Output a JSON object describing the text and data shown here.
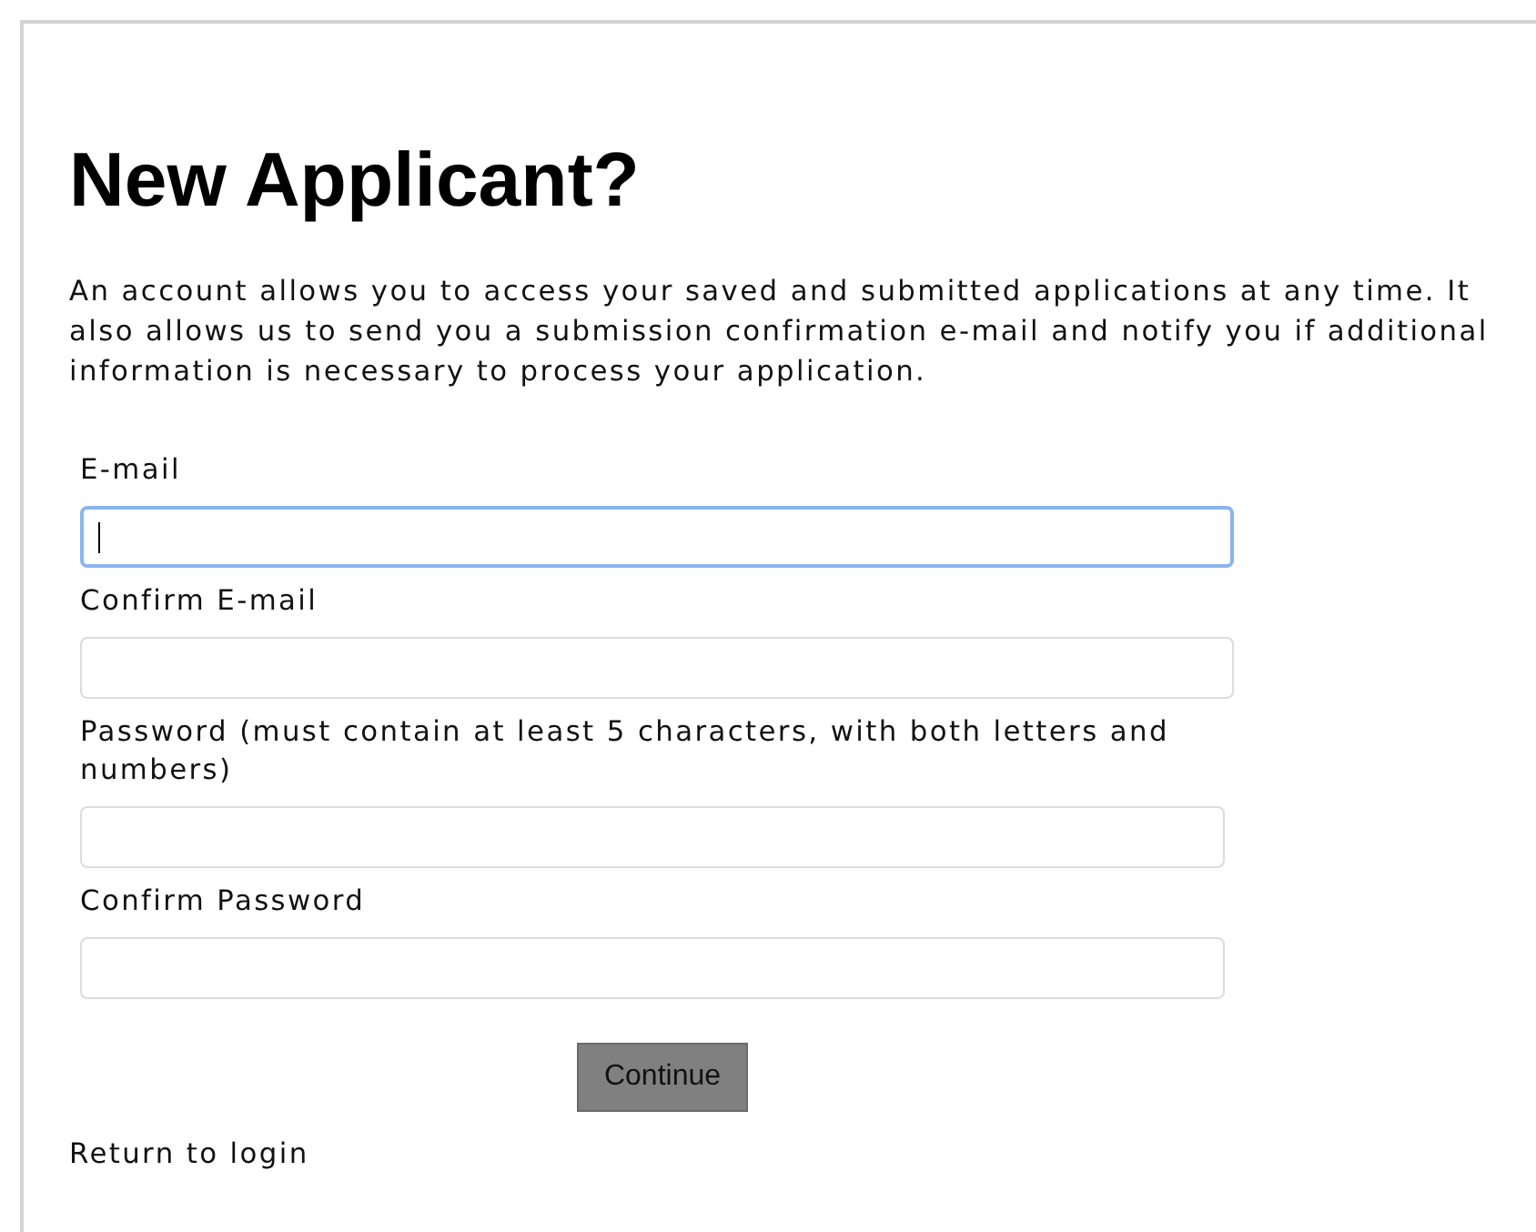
{
  "heading": "New Applicant?",
  "intro": "An account allows you to access your saved and submitted applications at any time. It also allows us to send you a submission confirmation e-mail and notify you if additional information is necessary to process your application.",
  "fields": [
    {
      "label": "E-mail",
      "focused": true
    },
    {
      "label": "Confirm E-mail",
      "focused": false
    },
    {
      "label": "Password (must contain at least 5 characters, with both letters and numbers)",
      "focused": false
    },
    {
      "label": "Confirm Password",
      "focused": false
    }
  ],
  "submit_button": "Continue",
  "return_link": "Return to login"
}
